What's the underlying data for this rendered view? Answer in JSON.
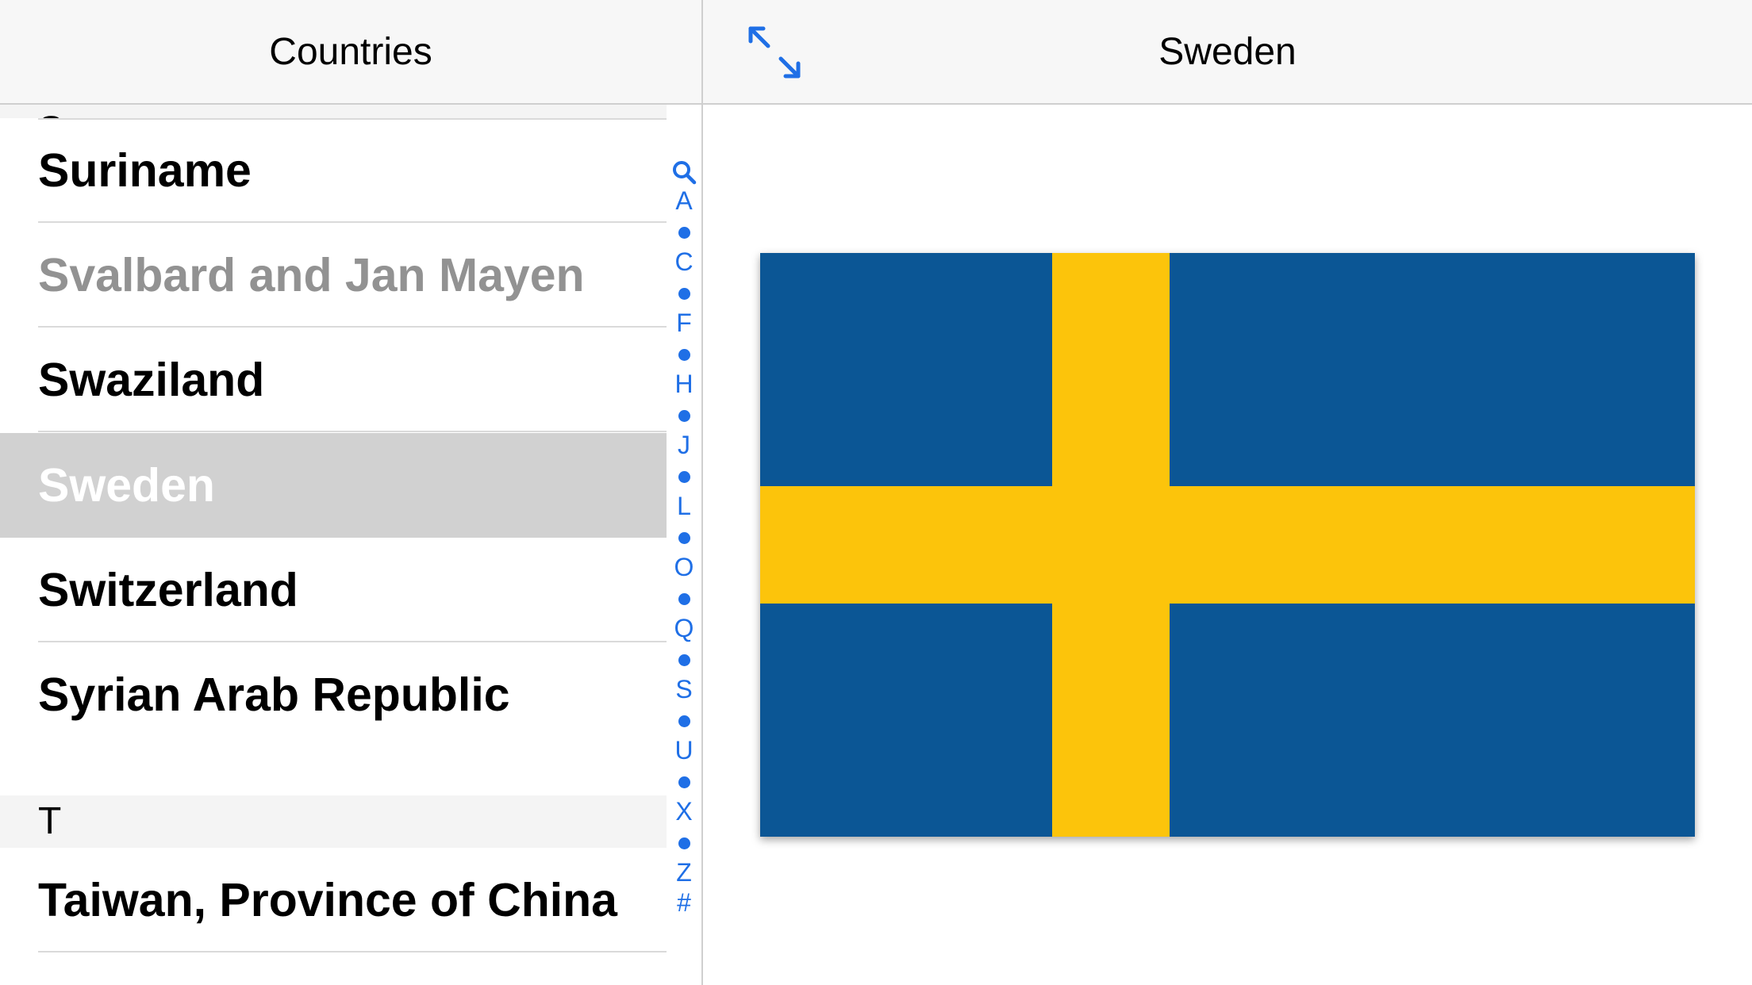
{
  "master": {
    "title": "Countries"
  },
  "list": {
    "sections": [
      {
        "header": "S",
        "rows": [
          {
            "label": "Suriname",
            "state": "normal"
          },
          {
            "label": "Svalbard and Jan Mayen",
            "state": "disabled"
          },
          {
            "label": "Swaziland",
            "state": "normal"
          },
          {
            "label": "Sweden",
            "state": "selected"
          },
          {
            "label": "Switzerland",
            "state": "normal"
          },
          {
            "label": "Syrian Arab Republic",
            "state": "normal"
          }
        ]
      },
      {
        "header": "T",
        "rows": [
          {
            "label": "Taiwan, Province of China",
            "state": "normal"
          }
        ]
      }
    ]
  },
  "section_index": {
    "entries": [
      "search-icon",
      "A",
      "•",
      "C",
      "•",
      "F",
      "•",
      "H",
      "•",
      "J",
      "•",
      "L",
      "•",
      "O",
      "•",
      "Q",
      "•",
      "S",
      "•",
      "U",
      "•",
      "X",
      "•",
      "Z",
      "#"
    ],
    "color": "#1f6fe6"
  },
  "detail": {
    "title": "Sweden",
    "expand_icon": "expand-arrows-icon",
    "flag": {
      "country": "Sweden",
      "blue": "#0b5695",
      "yellow": "#fcc40b"
    }
  }
}
